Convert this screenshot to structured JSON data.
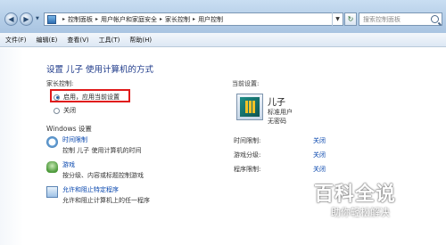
{
  "address_bar": {
    "crumbs": [
      "控制面板",
      "用户帐户和家庭安全",
      "家长控制",
      "用户控制"
    ],
    "search_placeholder": "搜索控制面板"
  },
  "menu": [
    "文件(F)",
    "编辑(E)",
    "查看(V)",
    "工具(T)",
    "帮助(H)"
  ],
  "main": {
    "heading": "设置 儿子 使用计算机的方式",
    "parental_label": "家长控制:",
    "options": [
      "启用，应用当前设置",
      "关闭"
    ],
    "selected_option": "启用，应用当前设置",
    "windows_settings_label": "Windows 设置",
    "settings": [
      {
        "title": "时间限制",
        "desc": "控制 儿子 使用计算机的时间",
        "icon": "clock-icon"
      },
      {
        "title": "游戏",
        "desc": "按分级、内容或标题控制游戏",
        "icon": "game-controller-icon"
      },
      {
        "title": "允许和阻止特定程序",
        "desc": "允许和阻止计算机上的任一程序",
        "icon": "program-list-icon"
      }
    ]
  },
  "current": {
    "label": "当前设置:",
    "user_name": "儿子",
    "user_type": "标准用户",
    "password": "无密码",
    "rows": [
      {
        "label": "时间限制:",
        "value": "关闭"
      },
      {
        "label": "游戏分级:",
        "value": "关闭"
      },
      {
        "label": "程序限制:",
        "value": "关闭"
      }
    ]
  },
  "watermark": {
    "title": "百科全说",
    "subtitle": "助你轻松解决"
  }
}
